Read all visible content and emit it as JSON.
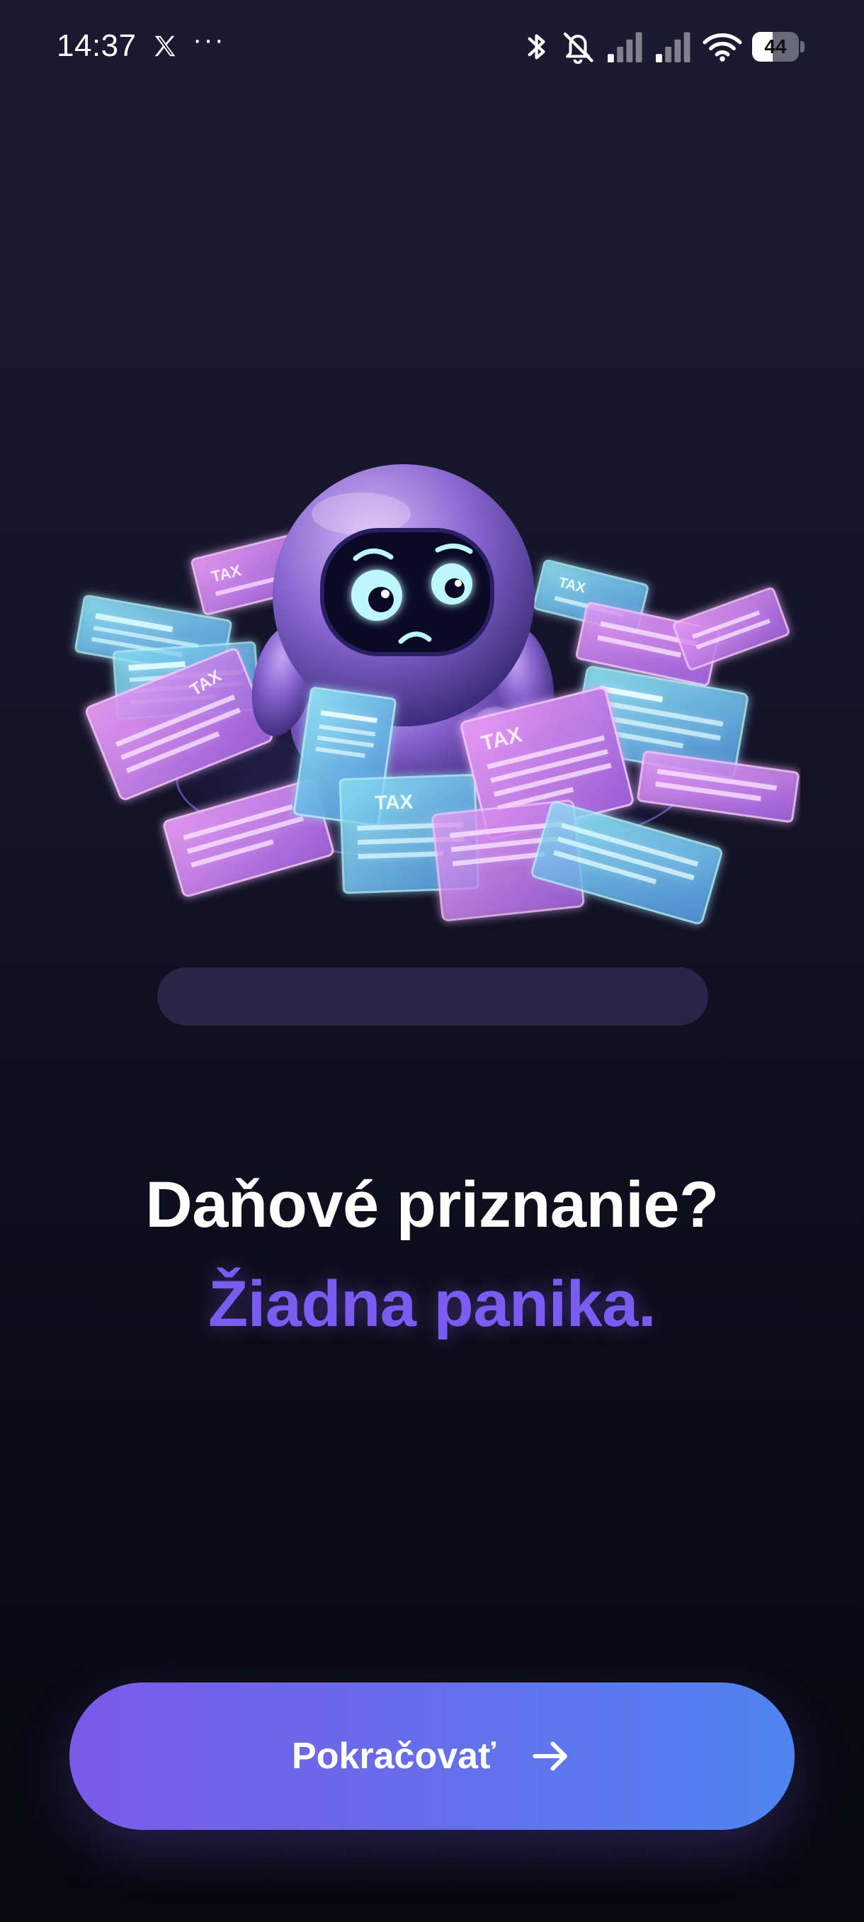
{
  "status_bar": {
    "time": "14:37",
    "x_icon": "x-logo-icon",
    "more": "···",
    "battery_level": "44",
    "battery_fraction": 0.44,
    "icons": [
      "bluetooth-icon",
      "mute-icon",
      "signal-icon",
      "signal-icon",
      "wifi-icon",
      "battery-icon"
    ]
  },
  "hero": {
    "illustration": "worried-robot-with-tax-papers",
    "paper_label": "TAX"
  },
  "headline": "Daňové priznanie?",
  "subline": "Žiadna panika.",
  "cta": {
    "label": "Pokračovať",
    "icon": "arrow-right-icon"
  },
  "colors": {
    "accent": "#7b5cf0",
    "button_start": "#7a5ae8",
    "button_end": "#4f84ef",
    "background": "#15142a"
  }
}
